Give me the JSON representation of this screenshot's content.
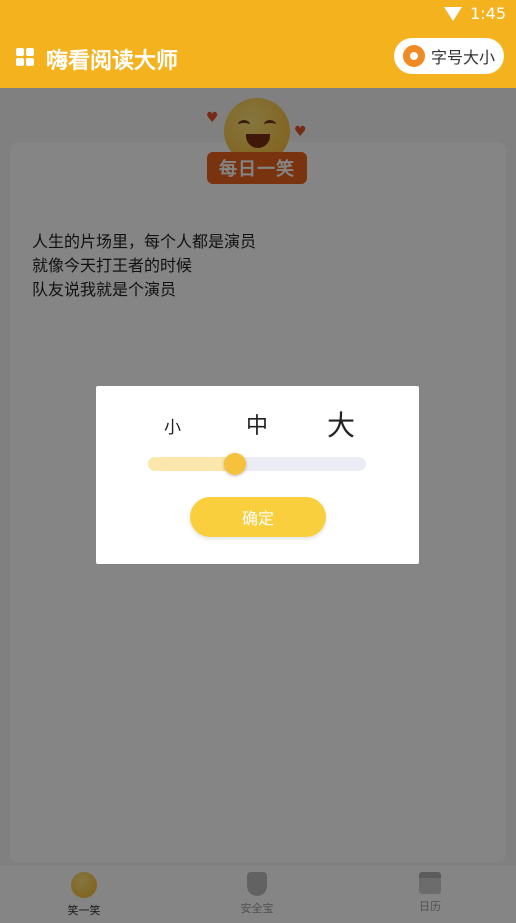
{
  "status_bar": {
    "time": "1:45"
  },
  "header": {
    "title": "嗨看阅读大师",
    "font_button_label": "字号大小"
  },
  "card": {
    "badge": "每日一笑",
    "joke_lines": [
      "人生的片场里，每个人都是演员",
      "就像今天打王者的时候",
      "队友说我就是个演员"
    ]
  },
  "dialog": {
    "size_options": [
      "小",
      "中",
      "大"
    ],
    "selected": "中",
    "slider_level": 0.4,
    "confirm_label": "确定"
  },
  "bottom_nav": [
    {
      "label": "笑一笑",
      "icon": "smile-icon",
      "active": true
    },
    {
      "label": "安全宝",
      "icon": "shield-icon",
      "active": false
    },
    {
      "label": "日历",
      "icon": "calendar-icon",
      "active": false
    }
  ],
  "colors": {
    "accent": "#f4b21f",
    "badge": "#e8631e",
    "button": "#f9cf3e"
  }
}
